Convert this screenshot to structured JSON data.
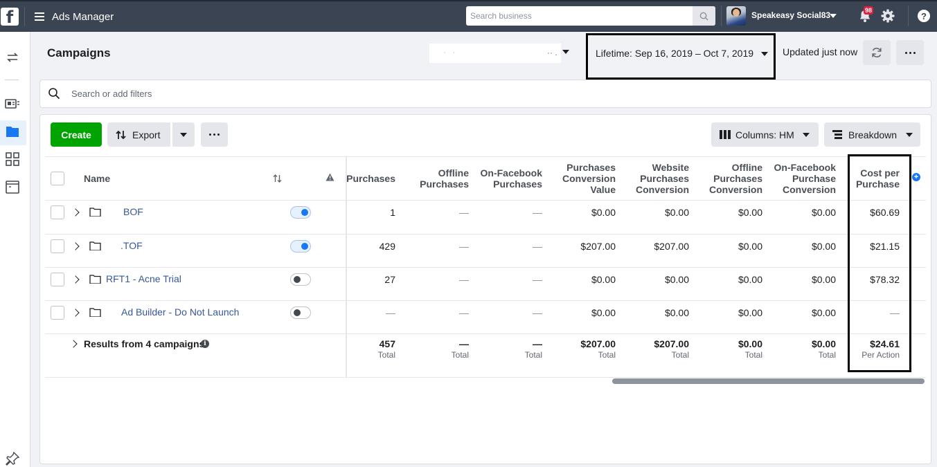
{
  "topbar": {
    "app_title": "Ads Manager",
    "search_placeholder": "Search business",
    "account_name": "Speakeasy Social83",
    "notification_count": "98"
  },
  "header": {
    "title": "Campaigns",
    "date_range": "Lifetime: Sep 16, 2019 – Oct 7, 2019",
    "updated": "Updated just now"
  },
  "filter": {
    "placeholder": "Search or add filters"
  },
  "toolbar": {
    "create_label": "Create",
    "export_label": "Export",
    "columns_label": "Columns: HM",
    "breakdown_label": "Breakdown"
  },
  "table": {
    "name_header": "Name",
    "headers": [
      [
        "Purchases"
      ],
      [
        "Offline",
        "Purchases"
      ],
      [
        "On-Facebook",
        "Purchases"
      ],
      [
        "Purchases",
        "Conversion",
        "Value"
      ],
      [
        "Website",
        "Purchases",
        "Conversion"
      ],
      [
        "Offline",
        "Purchases",
        "Conversion"
      ],
      [
        "On-Facebook",
        "Purchase",
        "Conversion"
      ],
      [
        "Cost per",
        "Purchase"
      ]
    ],
    "rows": [
      {
        "name": "BOF",
        "active": true,
        "values": [
          "1",
          "—",
          "—",
          "$0.00",
          "$0.00",
          "$0.00",
          "$0.00",
          "$60.69"
        ]
      },
      {
        "name": ".TOF",
        "active": true,
        "values": [
          "429",
          "—",
          "—",
          "$207.00",
          "$207.00",
          "$0.00",
          "$0.00",
          "$21.15"
        ]
      },
      {
        "name": "RFT1 - Acne Trial",
        "active": false,
        "values": [
          "27",
          "—",
          "—",
          "$0.00",
          "$0.00",
          "$0.00",
          "$0.00",
          "$78.32"
        ]
      },
      {
        "name": "Ad Builder - Do Not Launch",
        "active": false,
        "values": [
          "—",
          "—",
          "—",
          "$0.00",
          "$0.00",
          "$0.00",
          "$0.00",
          "—"
        ]
      }
    ],
    "summary": {
      "label": "Results from 4 campaigns",
      "values": [
        "457",
        "—",
        "—",
        "$207.00",
        "$207.00",
        "$0.00",
        "$0.00",
        "$24.61"
      ],
      "subs": [
        "Total",
        "Total",
        "Total",
        "Total",
        "Total",
        "Total",
        "Total",
        "Per Action"
      ]
    }
  },
  "colors": {
    "topbar": "#3b4452",
    "create_green": "#00a400",
    "link_blue": "#365899",
    "toggle_blue": "#1877f2",
    "badge_red": "#e41e3f"
  }
}
